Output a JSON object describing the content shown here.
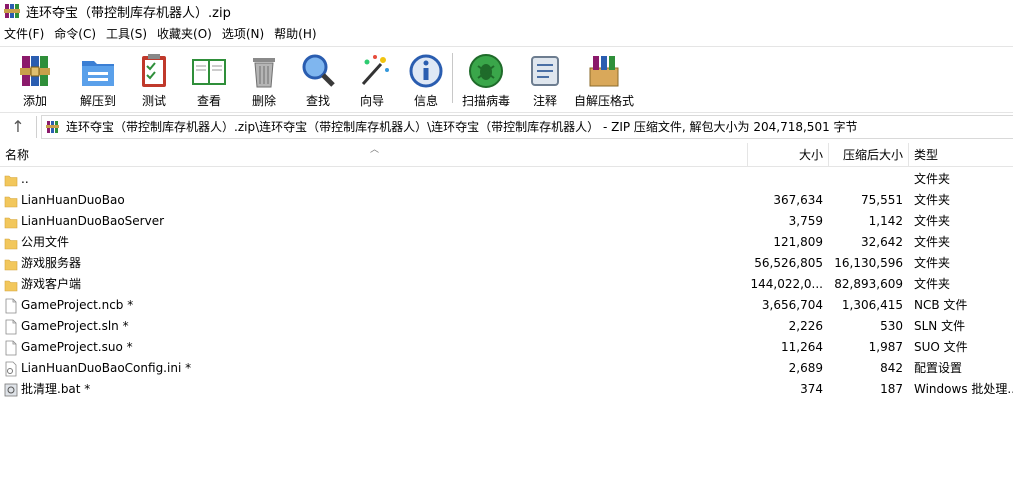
{
  "window": {
    "title": "连环夺宝（带控制库存机器人）.zip"
  },
  "menu": [
    {
      "label": "文件(F)"
    },
    {
      "label": "命令(C)"
    },
    {
      "label": "工具(S)"
    },
    {
      "label": "收藏夹(O)"
    },
    {
      "label": "选项(N)"
    },
    {
      "label": "帮助(H)"
    }
  ],
  "toolbar": [
    {
      "label": "添加",
      "icon": "add-archive-icon"
    },
    {
      "label": "解压到",
      "icon": "extract-folder-icon"
    },
    {
      "label": "测试",
      "icon": "test-clipboard-icon"
    },
    {
      "label": "查看",
      "icon": "view-book-icon"
    },
    {
      "label": "删除",
      "icon": "trash-icon"
    },
    {
      "label": "查找",
      "icon": "magnifier-icon"
    },
    {
      "label": "向导",
      "icon": "wizard-wand-icon"
    },
    {
      "label": "信息",
      "icon": "info-icon"
    },
    {
      "label": "扫描病毒",
      "icon": "virus-scan-icon"
    },
    {
      "label": "注释",
      "icon": "comment-icon"
    },
    {
      "label": "自解压格式",
      "icon": "sfx-box-icon"
    }
  ],
  "address": {
    "path": "连环夺宝（带控制库存机器人）.zip\\连环夺宝（带控制库存机器人）\\连环夺宝（带控制库存机器人） - ZIP 压缩文件, 解包大小为 204,718,501 字节"
  },
  "columns": {
    "name": "名称",
    "size": "大小",
    "packed": "压缩后大小",
    "type": "类型"
  },
  "files": [
    {
      "name": "..",
      "size": "",
      "packed": "",
      "type": "文件夹",
      "kind": "folder"
    },
    {
      "name": "LianHuanDuoBao",
      "size": "367,634",
      "packed": "75,551",
      "type": "文件夹",
      "kind": "folder"
    },
    {
      "name": "LianHuanDuoBaoServer",
      "size": "3,759",
      "packed": "1,142",
      "type": "文件夹",
      "kind": "folder"
    },
    {
      "name": "公用文件",
      "size": "121,809",
      "packed": "32,642",
      "type": "文件夹",
      "kind": "folder"
    },
    {
      "name": "游戏服务器",
      "size": "56,526,805",
      "packed": "16,130,596",
      "type": "文件夹",
      "kind": "folder"
    },
    {
      "name": "游戏客户端",
      "size": "144,022,0...",
      "packed": "82,893,609",
      "type": "文件夹",
      "kind": "folder"
    },
    {
      "name": "GameProject.ncb *",
      "size": "3,656,704",
      "packed": "1,306,415",
      "type": "NCB 文件",
      "kind": "file"
    },
    {
      "name": "GameProject.sln *",
      "size": "2,226",
      "packed": "530",
      "type": "SLN 文件",
      "kind": "file"
    },
    {
      "name": "GameProject.suo *",
      "size": "11,264",
      "packed": "1,987",
      "type": "SUO 文件",
      "kind": "file"
    },
    {
      "name": "LianHuanDuoBaoConfig.ini *",
      "size": "2,689",
      "packed": "842",
      "type": "配置设置",
      "kind": "ini"
    },
    {
      "name": "批清理.bat *",
      "size": "374",
      "packed": "187",
      "type": "Windows 批处理...",
      "kind": "bat"
    }
  ]
}
